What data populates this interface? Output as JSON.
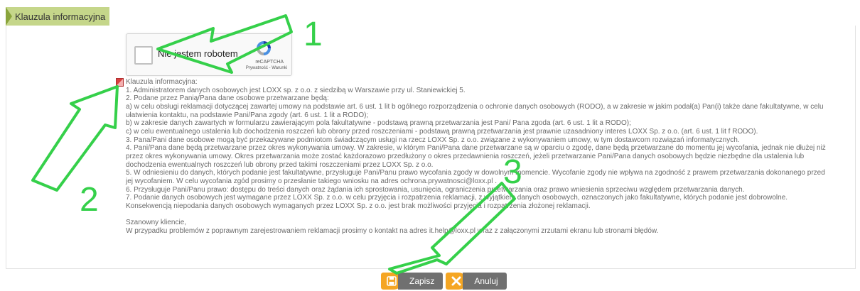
{
  "header": {
    "tab_title": "Klauzula informacyjna"
  },
  "captcha": {
    "label": "Nie jestem robotem",
    "brand": "reCAPTCHA",
    "links": "Prywatność - Warunki"
  },
  "clause": {
    "lines": [
      "Klauzula informacyjna:",
      "1. Administratorem danych osobowych jest LOXX sp. z o.o. z siedzibą w Warszawie przy ul. Staniewickiej 5.",
      "2. Podane przez Panią/Pana dane osobowe przetwarzane będą:",
      "a) w celu obsługi reklamacji dotyczącej zawartej umowy na podstawie art. 6 ust. 1 lit b ogólnego rozporządzenia o ochronie danych osobowych (RODO), a w zakresie w jakim podał(a) Pan(i) także dane fakultatywne, w celu",
      "ułatwienia kontaktu, na podstawie Pani/Pana zgody (art. 6 ust. 1 lit a RODO);",
      "b) w zakresie danych zawartych w formularzu zawierającym pola fakultatywne - podstawą prawną przetwarzania jest Pani/ Pana zgoda (art. 6 ust. 1 lit a RODO);",
      "c) w celu ewentualnego ustalenia lub dochodzenia roszczeń lub obrony przed roszczeniami - podstawą prawną przetwarzania jest prawnie uzasadniony interes LOXX Sp. z o.o. (art. 6 ust. 1 lit f RODO).",
      "3. Pana/Pani dane osobowe mogą być przekazywane podmiotom świadczącym usługi na rzecz LOXX Sp. z o.o. związane z wykonywaniem umowy, w tym dostawcom rozwiązań informatycznych.",
      "4. Pani/Pana dane będą przetwarzane przez okres wykonywania umowy. W zakresie, w którym Pani/Pana dane przetwarzane są w oparciu o zgodę, dane będą przetwarzane do momentu jej wycofania, jednak nie dłużej niż",
      "przez okres wykonywania umowy. Okres przetwarzania może zostać każdorazowo przedłużony o okres przedawnienia roszczeń, jeżeli przetwarzanie Pani/Pana danych osobowych będzie niezbędne dla ustalenia lub",
      "dochodzenia ewentualnych roszczeń lub obrony przed takimi roszczeniami przez LOXX Sp. z o.o.",
      "5. W odniesieniu do danych, których podanie jest fakultatywne, przysługuje Pani/Panu prawo wycofania zgody w dowolnym momencie. Wycofanie zgody nie wpływa na zgodność z prawem przetwarzania dokonanego przed",
      "jej wycofaniem. W celu wycofania zgód prosimy o przesłanie takiego wniosku na adres ochrona.prywatnosci@loxx.pl .",
      "6. Przysługuje Pani/Panu prawo: dostępu do treści danych oraz żądania ich sprostowania, usunięcia, ograniczenia przetwarzania oraz prawo wniesienia sprzeciwu względem przetwarzania danych.",
      "7. Podanie danych osobowych jest wymagane przez LOXX Sp. z o.o. w celu przyjęcia i rozpatrzenia reklamacji, z wyjątkiem danych osobowych, oznaczonych jako fakultatywne, których podanie jest dobrowolne.",
      "Konsekwencją niepodania danych osobowych wymaganych przez LOXX Sp. z o.o. jest brak możliwości przyjęcia i rozpatrzenia złożonej reklamacji.",
      "",
      "Szanowny kliencie,",
      "W przypadku problemów z poprawnym zarejestrowaniem reklamacji prosimy o kontakt na adres it.help@loxx.pl wraz z załączonymi zrzutami ekranu lub stronami błędów."
    ]
  },
  "buttons": {
    "save": "Zapisz",
    "cancel": "Anuluj"
  },
  "annotations": {
    "n1": "1",
    "n2": "2",
    "n3": "3"
  },
  "colors": {
    "tab_bg": "#c5d68a",
    "button_accent": "#f5a623",
    "button_label_bg": "#707070",
    "annotation": "#35d04a"
  },
  "icons": {
    "tab": "triangle-marker-icon",
    "captcha": "recaptcha-logo-icon",
    "doc": "document-icon",
    "save": "floppy-disk-icon",
    "cancel": "close-x-icon"
  }
}
